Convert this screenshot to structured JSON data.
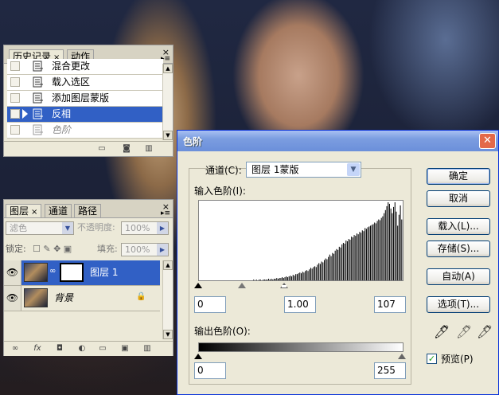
{
  "history": {
    "tabs": [
      "历史记录",
      "动作"
    ],
    "tab_close": "×",
    "close": "×",
    "items": [
      {
        "label": "混合更改",
        "selected": false,
        "dimmed": false
      },
      {
        "label": "载入选区",
        "selected": false,
        "dimmed": false
      },
      {
        "label": "添加图层蒙版",
        "selected": false,
        "dimmed": false
      },
      {
        "label": "反相",
        "selected": true,
        "dimmed": false
      },
      {
        "label": "色阶",
        "selected": false,
        "dimmed": true
      }
    ]
  },
  "layers": {
    "tabs": [
      "图层",
      "通道",
      "路径"
    ],
    "tab_close": "×",
    "close": "×",
    "blend_mode": "滤色",
    "opacity_label": "不透明度:",
    "opacity_value": "100%",
    "lock_label": "锁定:",
    "fill_label": "填充:",
    "fill_value": "100%",
    "items": [
      {
        "name": "图层 1",
        "selected": true
      },
      {
        "name": "背景",
        "selected": false
      }
    ],
    "footer_icons": [
      "link-icon",
      "fx-icon",
      "mask-icon",
      "adjustment-icon",
      "folder-icon",
      "new-layer-icon",
      "trash-icon"
    ]
  },
  "levels": {
    "title": "色阶",
    "channel_label": "通道(C):",
    "channel_value": "图层 1蒙版",
    "input_label": "输入色阶(I):",
    "input_values": [
      "0",
      "1.00",
      "107"
    ],
    "output_label": "输出色阶(O):",
    "output_values": [
      "0",
      "255"
    ],
    "buttons": {
      "ok": "确定",
      "cancel": "取消",
      "load": "载入(L)...",
      "save": "存储(S)...",
      "auto": "自动(A)",
      "options": "选项(T)..."
    },
    "preview_label": "预览(P)",
    "preview_checked": true,
    "histogram": [
      0,
      0,
      0,
      0,
      0,
      0,
      0,
      0,
      0,
      0,
      0,
      0,
      0,
      0,
      0,
      0,
      0,
      0,
      0,
      0,
      0,
      0,
      0,
      0,
      0,
      0,
      0,
      0,
      0,
      0,
      0,
      0,
      0,
      0,
      0,
      0,
      0,
      0,
      0,
      0,
      1,
      0,
      1,
      0,
      1,
      1,
      0,
      1,
      1,
      1,
      1,
      2,
      1,
      2,
      1,
      2,
      2,
      3,
      2,
      3,
      3,
      4,
      3,
      4,
      5,
      4,
      5,
      6,
      5,
      7,
      6,
      8,
      8,
      9,
      10,
      9,
      11,
      10,
      12,
      13,
      12,
      14,
      16,
      15,
      17,
      18,
      17,
      20,
      22,
      21,
      24,
      23,
      26,
      28,
      27,
      30,
      33,
      31,
      35,
      34,
      38,
      40,
      39,
      43,
      42,
      46,
      48,
      47,
      51,
      50,
      53,
      52,
      56,
      55,
      58,
      57,
      60,
      59,
      62,
      61,
      64,
      63,
      67,
      66,
      68,
      69,
      70,
      71,
      72,
      74,
      73,
      76,
      78,
      77,
      80,
      82,
      86,
      90,
      95,
      100,
      98,
      92,
      86,
      94,
      100,
      88,
      70,
      84,
      96,
      78
    ],
    "colors": {
      "title_bar": "#7b9de0",
      "selection": "#3160c5"
    }
  }
}
